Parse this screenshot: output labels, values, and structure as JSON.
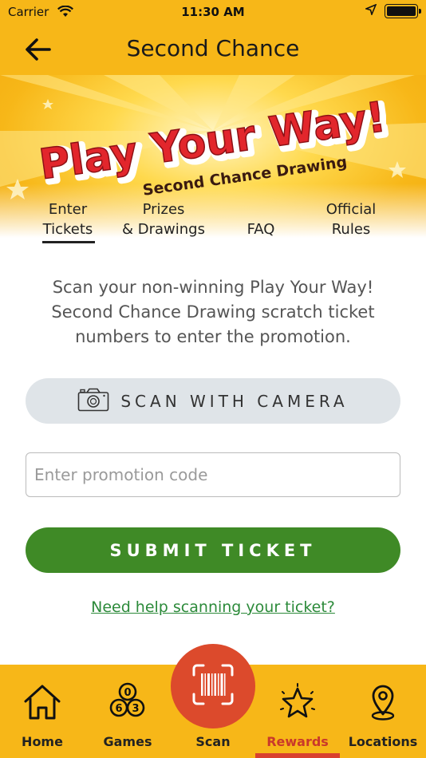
{
  "status_bar": {
    "carrier": "Carrier",
    "time": "11:30 AM",
    "battery_level": 1.0
  },
  "nav": {
    "title": "Second Chance",
    "back_icon": "back-arrow-icon"
  },
  "hero": {
    "headline": "Play Your Way!",
    "subhead": "Second Chance Drawing"
  },
  "tabs": [
    {
      "line1": "Enter",
      "line2": "Tickets",
      "selected": true
    },
    {
      "line1": "Prizes",
      "line2": "& Drawings"
    },
    {
      "line1": "FAQ"
    },
    {
      "line1": "Official",
      "line2": "Rules"
    }
  ],
  "intro": {
    "line1": "Scan your non-winning Play Your Way!",
    "line2": "Second Chance Drawing scratch ticket",
    "line3": "numbers to enter the promotion."
  },
  "scan_button": {
    "label": "SCAN WITH CAMERA",
    "icon": "camera-icon"
  },
  "promo_input": {
    "placeholder": "Enter promotion code",
    "value": ""
  },
  "submit_button": {
    "label": "SUBMIT TICKET"
  },
  "help_link": {
    "label": "Need help scanning your ticket?"
  },
  "tab_bar": {
    "items": [
      {
        "label": "Home",
        "icon": "home-icon"
      },
      {
        "label": "Games",
        "icon": "lottery-balls-icon"
      },
      {
        "label": "Scan",
        "icon": "barcode-scan-icon"
      },
      {
        "label": "Rewards",
        "icon": "star-icon",
        "active": true
      },
      {
        "label": "Locations",
        "icon": "location-pin-icon"
      }
    ]
  },
  "colors": {
    "brand_yellow": "#f7b718",
    "submit_green": "#3f8a26",
    "scan_orange": "#dc4a2c",
    "active_red": "#c9392b",
    "link_green": "#2c8a3a"
  }
}
